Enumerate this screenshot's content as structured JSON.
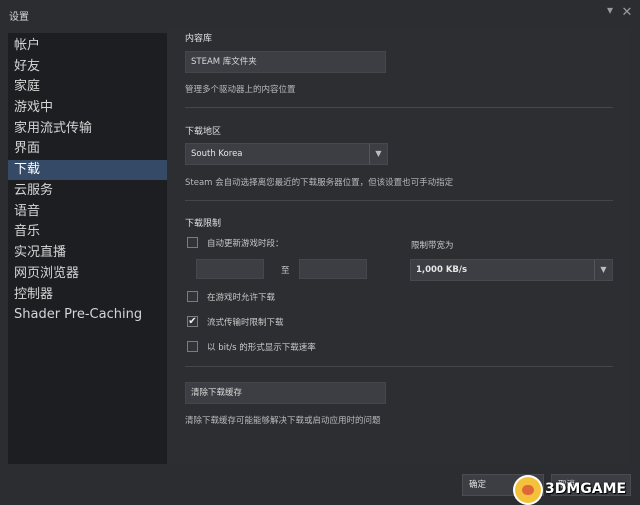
{
  "window": {
    "title": "设置",
    "minimize_glyph": "▾",
    "close_glyph": "✕"
  },
  "sidebar": {
    "items": [
      {
        "label": "帐户"
      },
      {
        "label": "好友"
      },
      {
        "label": "家庭"
      },
      {
        "label": "游戏中"
      },
      {
        "label": "家用流式传输"
      },
      {
        "label": "界面"
      },
      {
        "label": "下载",
        "active": true
      },
      {
        "label": "云服务"
      },
      {
        "label": "语音"
      },
      {
        "label": "音乐"
      },
      {
        "label": "实况直播"
      },
      {
        "label": "网页浏览器"
      },
      {
        "label": "控制器"
      },
      {
        "label": "Shader Pre-Caching"
      }
    ]
  },
  "library": {
    "heading": "内容库",
    "button": "STEAM 库文件夹",
    "description": "管理多个驱动器上的内容位置"
  },
  "region": {
    "heading": "下载地区",
    "selected": "South Korea",
    "description": "Steam 会自动选择离您最近的下载服务器位置，但该设置也可手动指定"
  },
  "restrictions": {
    "heading": "下载限制",
    "auto_update_label": "自动更新游戏时段：",
    "auto_update_checked": false,
    "time_separator": "至",
    "bandwidth_label": "限制带宽为",
    "bandwidth_value": "1,000 KB/s",
    "allow_ingame_label": "在游戏时允许下载",
    "allow_ingame_checked": false,
    "throttle_stream_label": "流式传输时限制下载",
    "throttle_stream_checked": true,
    "bits_label": "以 bit/s 的形式显示下载速率",
    "bits_checked": false,
    "check_glyph": "✔"
  },
  "cache": {
    "button": "清除下载缓存",
    "description": "清除下载缓存可能能够解决下载或启动应用时的问题"
  },
  "footer": {
    "ok": "确定",
    "cancel": "取消"
  },
  "watermark": {
    "text": "3DMGAME"
  },
  "icons": {
    "dropdown": "chevron-down-icon"
  }
}
